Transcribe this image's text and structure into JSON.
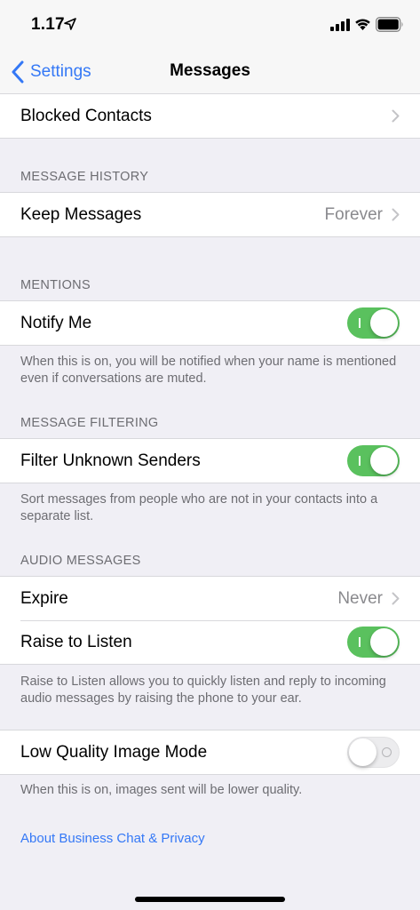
{
  "status_bar": {
    "time": "1.17"
  },
  "nav": {
    "back_label": "Settings",
    "title": "Messages"
  },
  "blocked": {
    "label": "Blocked Contacts"
  },
  "message_history": {
    "header": "MESSAGE HISTORY",
    "keep_label": "Keep Messages",
    "keep_value": "Forever"
  },
  "mentions": {
    "header": "MENTIONS",
    "notify_label": "Notify Me",
    "notify_on": true,
    "footer": "When this is on, you will be notified when your name is mentioned even if conversations are muted."
  },
  "message_filtering": {
    "header": "MESSAGE FILTERING",
    "filter_label": "Filter Unknown Senders",
    "filter_on": true,
    "footer": "Sort messages from people who are not in your contacts into a separate list."
  },
  "audio_messages": {
    "header": "AUDIO MESSAGES",
    "expire_label": "Expire",
    "expire_value": "Never",
    "raise_label": "Raise to Listen",
    "raise_on": true,
    "footer": "Raise to Listen allows you to quickly listen and reply to incoming audio messages by raising the phone to your ear."
  },
  "low_quality": {
    "label": "Low Quality Image Mode",
    "on": false,
    "footer": "When this is on, images sent will be lower quality."
  },
  "about_link": "About Business Chat & Privacy",
  "colors": {
    "accent": "#3478f6",
    "toggle_on": "#5ac15e",
    "background": "#f0eff5"
  },
  "icons": {
    "location": "location-arrow-icon",
    "signal": "cellular-signal-icon",
    "wifi": "wifi-icon",
    "battery": "battery-icon",
    "back": "chevron-left-icon",
    "disclosure": "chevron-right-icon"
  }
}
